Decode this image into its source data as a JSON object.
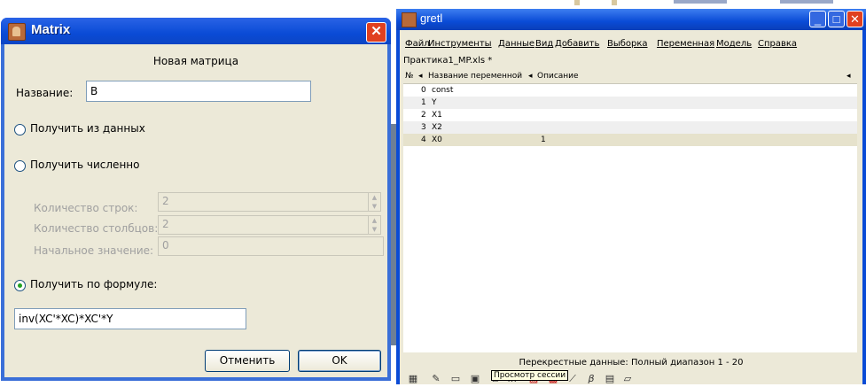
{
  "matrix_dialog": {
    "title": "Matrix",
    "close_glyph": "✕",
    "heading": "Новая матрица",
    "name_label": "Название:",
    "name_value": "B",
    "radio_from_data": "Получить из данных",
    "radio_numeric": "Получить численно",
    "rows_label": "Количество строк:",
    "rows_value": "2",
    "cols_label": "Количество столбцов:",
    "cols_value": "2",
    "init_label": "Начальное значение:",
    "init_value": "0",
    "radio_formula": "Получить по формуле:",
    "formula_value": "inv(XC'*XC)*XC'*Y",
    "cancel_button": "Отменить",
    "ok_button": "OK",
    "selected_option": "formula"
  },
  "gretl_window": {
    "title": "gretl",
    "menu": [
      "Файл",
      "Инструменты",
      "Данные",
      "Вид",
      "Добавить",
      "Выборка",
      "Переменная",
      "Модель",
      "Справка"
    ],
    "filename": "Практика1_MP.xls *",
    "columns": [
      "№",
      "Название переменной",
      "Описание"
    ],
    "rows": [
      {
        "num": "0",
        "name": "const",
        "desc": ""
      },
      {
        "num": "1",
        "name": "Y",
        "desc": ""
      },
      {
        "num": "2",
        "name": "X1",
        "desc": ""
      },
      {
        "num": "3",
        "name": "X2",
        "desc": ""
      },
      {
        "num": "4",
        "name": "X0",
        "desc": "1"
      }
    ],
    "status": "Перекрестные данные: Полный диапазон 1 - 20",
    "tooltip": "Просмотр сессии",
    "toolbar_icons": [
      "calculator-icon",
      "edit-icon",
      "terminal-icon",
      "session-icon",
      "window-icon",
      "function-icon",
      "pdf-icon",
      "help-icon",
      "plot-icon",
      "beta-icon",
      "database-icon",
      "folder-icon"
    ]
  }
}
